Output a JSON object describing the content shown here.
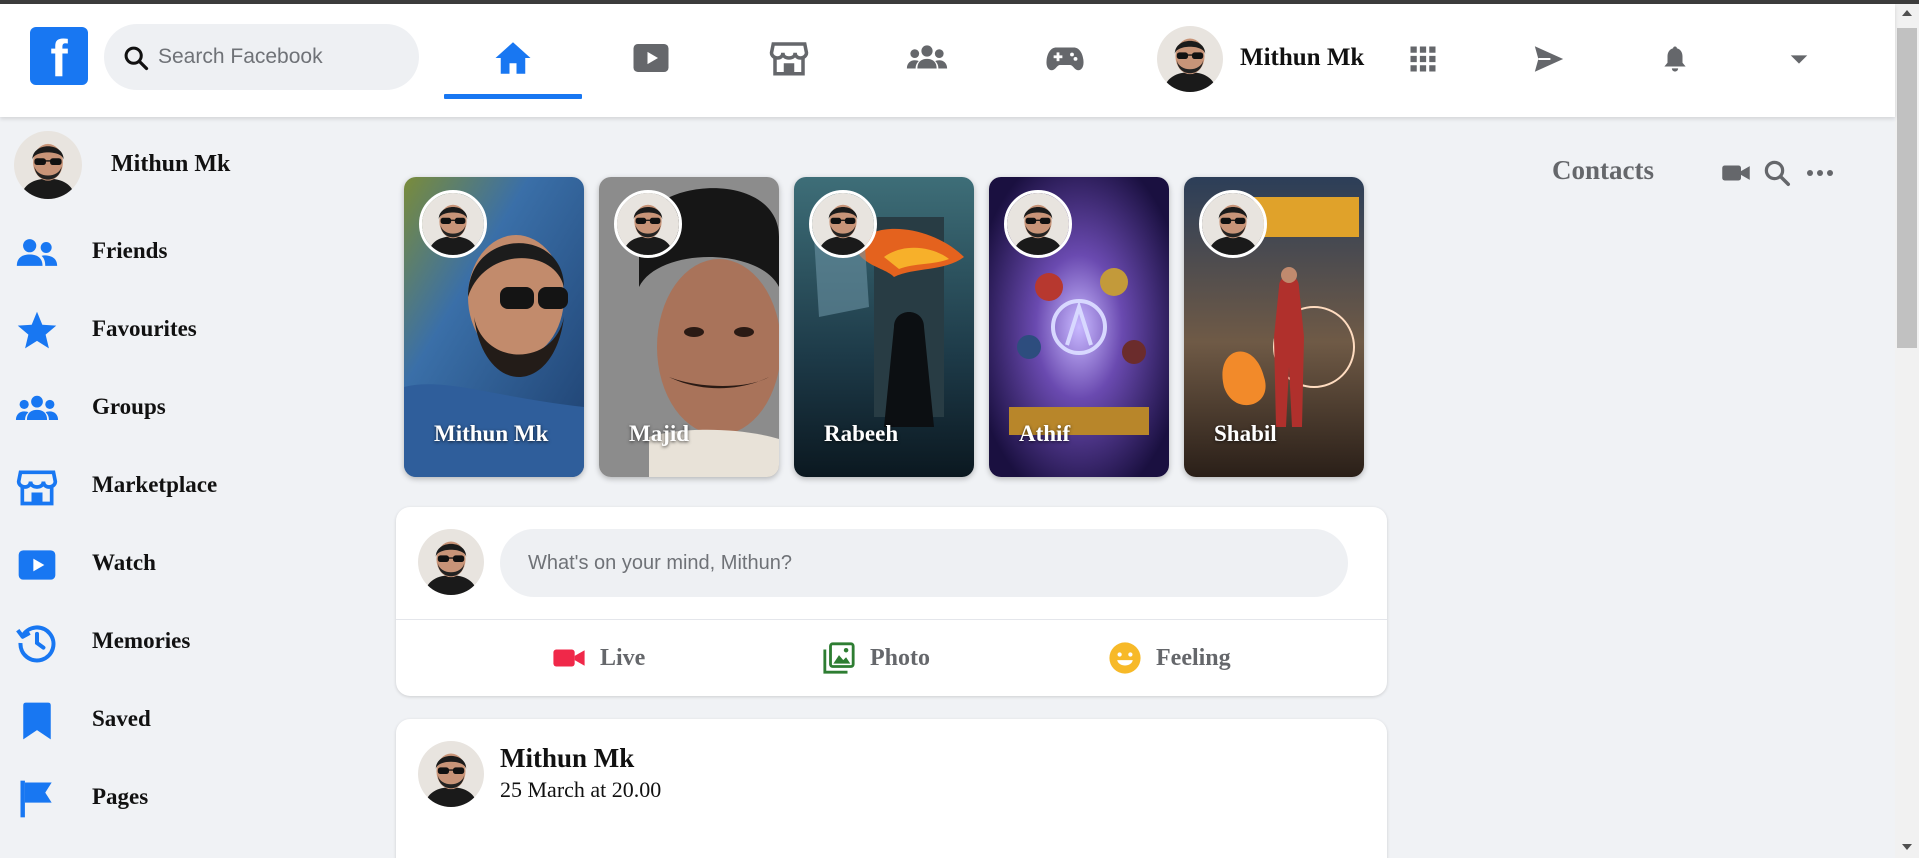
{
  "app": {
    "brand_color": "#1877f2",
    "logo_letter": "f"
  },
  "header": {
    "search_placeholder": "Search Facebook",
    "nav_tabs": [
      {
        "id": "home",
        "icon": "home-icon",
        "active": true
      },
      {
        "id": "watch",
        "icon": "play-icon",
        "active": false
      },
      {
        "id": "marketplace",
        "icon": "store-icon",
        "active": false
      },
      {
        "id": "groups",
        "icon": "groups-icon",
        "active": false
      },
      {
        "id": "gaming",
        "icon": "gamepad-icon",
        "active": false
      }
    ],
    "user_name": "Mithun Mk",
    "right_icons": [
      "apps-grid-icon",
      "send-icon",
      "bell-icon",
      "caret-down-icon"
    ]
  },
  "sidebar": {
    "profile_name": "Mithun Mk",
    "items": [
      {
        "label": "Friends",
        "icon": "friends-icon"
      },
      {
        "label": "Favourites",
        "icon": "star-icon"
      },
      {
        "label": "Groups",
        "icon": "groups-icon"
      },
      {
        "label": "Marketplace",
        "icon": "store-icon"
      },
      {
        "label": "Watch",
        "icon": "play-icon"
      },
      {
        "label": "Memories",
        "icon": "history-icon"
      },
      {
        "label": "Saved",
        "icon": "bookmark-icon"
      },
      {
        "label": "Pages",
        "icon": "flag-icon"
      }
    ]
  },
  "stories": [
    {
      "name": "Mithun Mk"
    },
    {
      "name": "Majid"
    },
    {
      "name": "Rabeeh"
    },
    {
      "name": "Athif"
    },
    {
      "name": "Shabil"
    }
  ],
  "composer": {
    "placeholder": "What's on your mind, Mithun?",
    "actions": [
      {
        "label": "Live",
        "icon": "video-camera-icon",
        "color": "#f02849"
      },
      {
        "label": "Photo",
        "icon": "photo-icon",
        "color": "#2e7d32"
      },
      {
        "label": "Feeling",
        "icon": "smiley-icon",
        "color": "#f7b928"
      }
    ]
  },
  "post": {
    "author": "Mithun Mk",
    "timestamp": "25 March at 20.00"
  },
  "contacts": {
    "title": "Contacts",
    "icons": [
      "video-camera-icon",
      "search-icon",
      "more-dots-icon"
    ]
  }
}
